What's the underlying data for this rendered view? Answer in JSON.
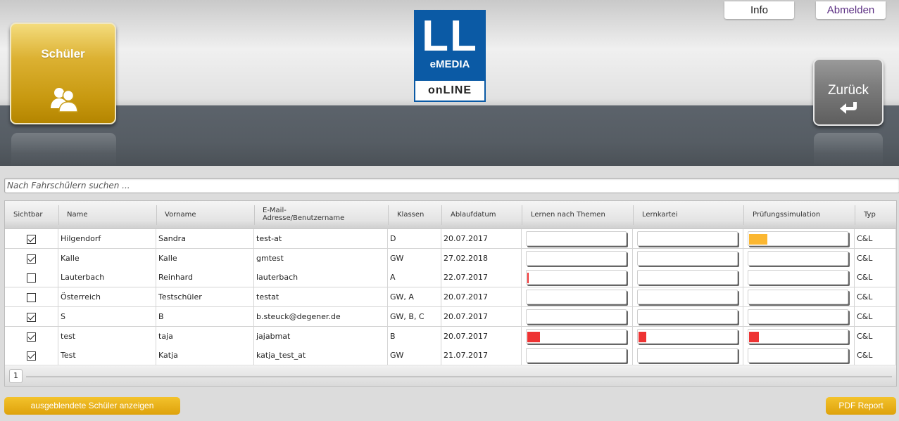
{
  "header": {
    "schueler_tile_label": "Schüler",
    "zurueck_tile_label": "Zurück",
    "logo_ll": "LL",
    "logo_emedia": "eMEDIA",
    "logo_online": "onLINE",
    "info_label": "Info",
    "logout_label": "Abmelden"
  },
  "search": {
    "placeholder": "Nach Fahrschülern suchen ..."
  },
  "table": {
    "columns": [
      "Sichtbar",
      "Name",
      "Vorname",
      "E-Mail-Adresse/Benutzername",
      "Klassen",
      "Ablaufdatum",
      "Lernen nach Themen",
      "Lernkartei",
      "Prüfungssimulation",
      "Typ"
    ],
    "email_header_line1": "E-Mail-",
    "email_header_line2": "Adresse/Benutzername",
    "rows": [
      {
        "visible": true,
        "name": "Hilgendorf",
        "vorname": "Sandra",
        "email": "test-at",
        "klassen": "D",
        "datum": "20.07.2017",
        "progress": {
          "themen": 0,
          "kartei": 0,
          "pruefung": 0.19
        },
        "pruefung_color": "#fbb731",
        "typ": "C&L"
      },
      {
        "visible": true,
        "name": "Kalle",
        "vorname": "Kalle",
        "email": "gmtest",
        "klassen": "GW",
        "datum": "27.02.2018",
        "progress": {
          "themen": 0,
          "kartei": 0,
          "pruefung": 0
        },
        "typ": "C&L"
      },
      {
        "visible": false,
        "name": "Lauterbach",
        "vorname": "Reinhard",
        "email": "lauterbach",
        "klassen": "A",
        "datum": "22.07.2017",
        "progress": {
          "themen": 0.015,
          "kartei": 0,
          "pruefung": 0
        },
        "typ": "C&L"
      },
      {
        "visible": false,
        "name": "Österreich",
        "vorname": "Testschüler",
        "email": "testat",
        "klassen": "GW, A",
        "datum": "20.07.2017",
        "progress": {
          "themen": 0,
          "kartei": 0,
          "pruefung": 0
        },
        "typ": "C&L"
      },
      {
        "visible": true,
        "name": "S",
        "vorname": "B",
        "email": "b.steuck@degener.de",
        "klassen": "GW, B, C",
        "datum": "20.07.2017",
        "progress": {
          "themen": 0,
          "kartei": 0,
          "pruefung": 0
        },
        "typ": "C&L"
      },
      {
        "visible": true,
        "name": "test",
        "vorname": "taja",
        "email": "jajabmat",
        "klassen": "B",
        "datum": "20.07.2017",
        "progress": {
          "themen": 0.13,
          "kartei": 0.08,
          "pruefung": 0.1
        },
        "typ": "C&L"
      },
      {
        "visible": true,
        "name": "Test",
        "vorname": "Katja",
        "email": "katja_test_at",
        "klassen": "GW",
        "datum": "21.07.2017",
        "progress": {
          "themen": 0,
          "kartei": 0,
          "pruefung": 0
        },
        "typ": "C&L"
      }
    ]
  },
  "pager": {
    "current_page": "1"
  },
  "buttons": {
    "show_hidden": "ausgeblendete Schüler anzeigen",
    "pdf_report": "PDF Report"
  },
  "colors": {
    "accent_gold": "#dea20b",
    "logo_blue": "#0b5aa5",
    "progress_low": "#ee3333",
    "progress_mid": "#fbb731"
  }
}
